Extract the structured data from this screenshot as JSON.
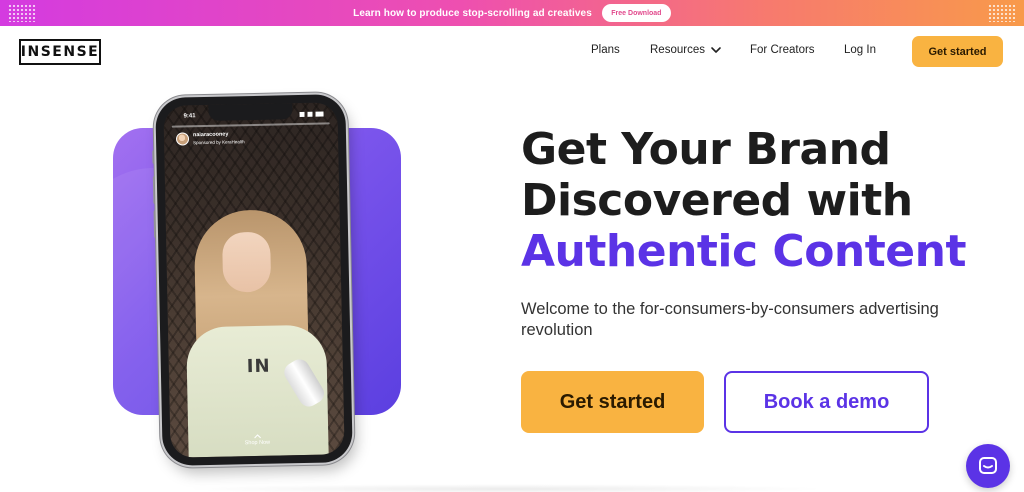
{
  "promo": {
    "text": "Learn how to produce stop-scrolling ad creatives",
    "button_label": "Free Download"
  },
  "header": {
    "logo_text": "INSENSE",
    "nav": {
      "plans": "Plans",
      "resources": "Resources",
      "creators": "For Creators",
      "login": "Log In"
    },
    "cta_label": "Get started"
  },
  "phone_ad": {
    "time": "9:41",
    "username": "naiaracooney",
    "sponsored": "Sponsored by KeraHealth",
    "shirt_print": "IN",
    "cta": "Shop Now"
  },
  "hero": {
    "title_line1": "Get Your Brand",
    "title_line2": "Discovered with",
    "title_accent": "Authentic Content",
    "subtitle": "Welcome to the for-consumers-by-consumers advertising revolution",
    "primary_cta": "Get started",
    "secondary_cta": "Book a demo"
  },
  "colors": {
    "accent_purple": "#5b33e6",
    "cta_yellow": "#f9b341",
    "promo_gradient_start": "#d43be0",
    "promo_gradient_end": "#f89a4a"
  },
  "icons": {
    "resources_dropdown": "chevron-down-icon",
    "chat": "chat-icon"
  }
}
